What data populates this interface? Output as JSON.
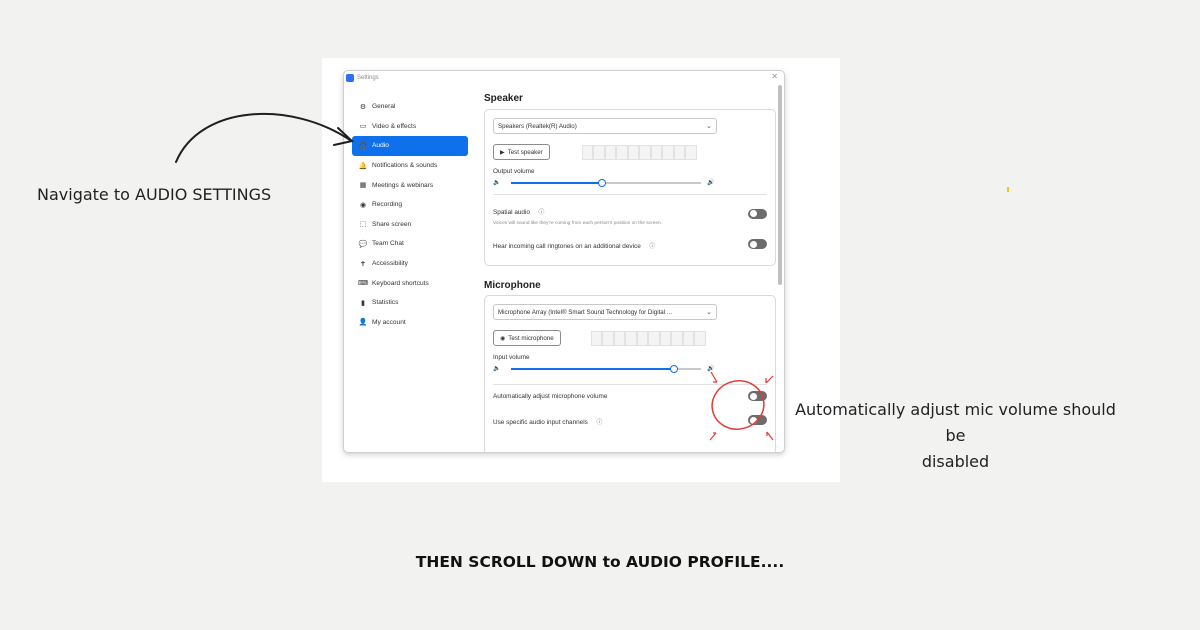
{
  "window": {
    "title": "Settings",
    "close_glyph": "✕"
  },
  "sidebar": {
    "items": [
      {
        "label": "General",
        "icon": "⚙"
      },
      {
        "label": "Video & effects",
        "icon": "▭"
      },
      {
        "label": "Audio",
        "icon": "🎧"
      },
      {
        "label": "Notifications & sounds",
        "icon": "🔔"
      },
      {
        "label": "Meetings & webinars",
        "icon": "▦"
      },
      {
        "label": "Recording",
        "icon": "◉"
      },
      {
        "label": "Share screen",
        "icon": "⬚"
      },
      {
        "label": "Team Chat",
        "icon": "💬"
      },
      {
        "label": "Accessibility",
        "icon": "✝"
      },
      {
        "label": "Keyboard shortcuts",
        "icon": "⌨"
      },
      {
        "label": "Statistics",
        "icon": "▮"
      },
      {
        "label": "My account",
        "icon": "👤"
      }
    ]
  },
  "speaker": {
    "title": "Speaker",
    "device": "Speakers (Realtek(R) Audio)",
    "test_button": "Test speaker",
    "output_volume_label": "Output volume",
    "output_volume_percent": 48,
    "spatial_audio_label": "Spatial audio",
    "spatial_audio_desc": "Voices will sound like they're coming from each person's position on the screen.",
    "ringtone_label": "Hear incoming call ringtones on an additional device"
  },
  "microphone": {
    "title": "Microphone",
    "device": "Microphone Array (Intel® Smart Sound Technology for Digital ...",
    "test_button": "Test microphone",
    "input_volume_label": "Input volume",
    "input_volume_percent": 86,
    "auto_adjust_label": "Automatically adjust microphone volume",
    "specific_channels_label": "Use specific audio input channels"
  },
  "annotations": {
    "navigate": "Navigate to AUDIO SETTINGS",
    "auto_adjust_line1": "Automatically adjust mic volume should be",
    "auto_adjust_line2": "disabled",
    "bottom": "THEN SCROLL DOWN to AUDIO PROFILE...."
  },
  "colors": {
    "accent": "#0e71eb",
    "annotation_red": "#e53935"
  }
}
